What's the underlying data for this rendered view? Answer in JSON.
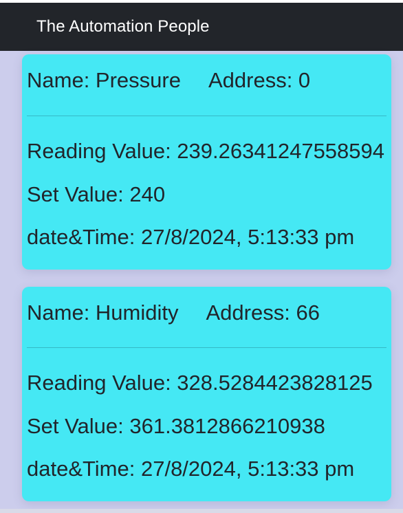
{
  "header": {
    "title": "The Automation People"
  },
  "devices": [
    {
      "name_label": "Name: Pressure",
      "address_label": "Address: 0",
      "reading_label": "Reading Value: 239.26341247558594",
      "set_label": "Set Value: 240",
      "datetime_label": "date&Time: 27/8/2024, 5:13:33 pm"
    },
    {
      "name_label": "Name: Humidity",
      "address_label": "Address: 66",
      "reading_label": "Reading Value: 328.5284423828125",
      "set_label": "Set Value: 361.3812866210938",
      "datetime_label": "date&Time: 27/8/2024, 5:13:33 pm"
    }
  ],
  "colors": {
    "header_bg": "#22252a",
    "page_bg": "#cccdec",
    "card_bg": "#45e8f4",
    "text": "#21252b"
  }
}
